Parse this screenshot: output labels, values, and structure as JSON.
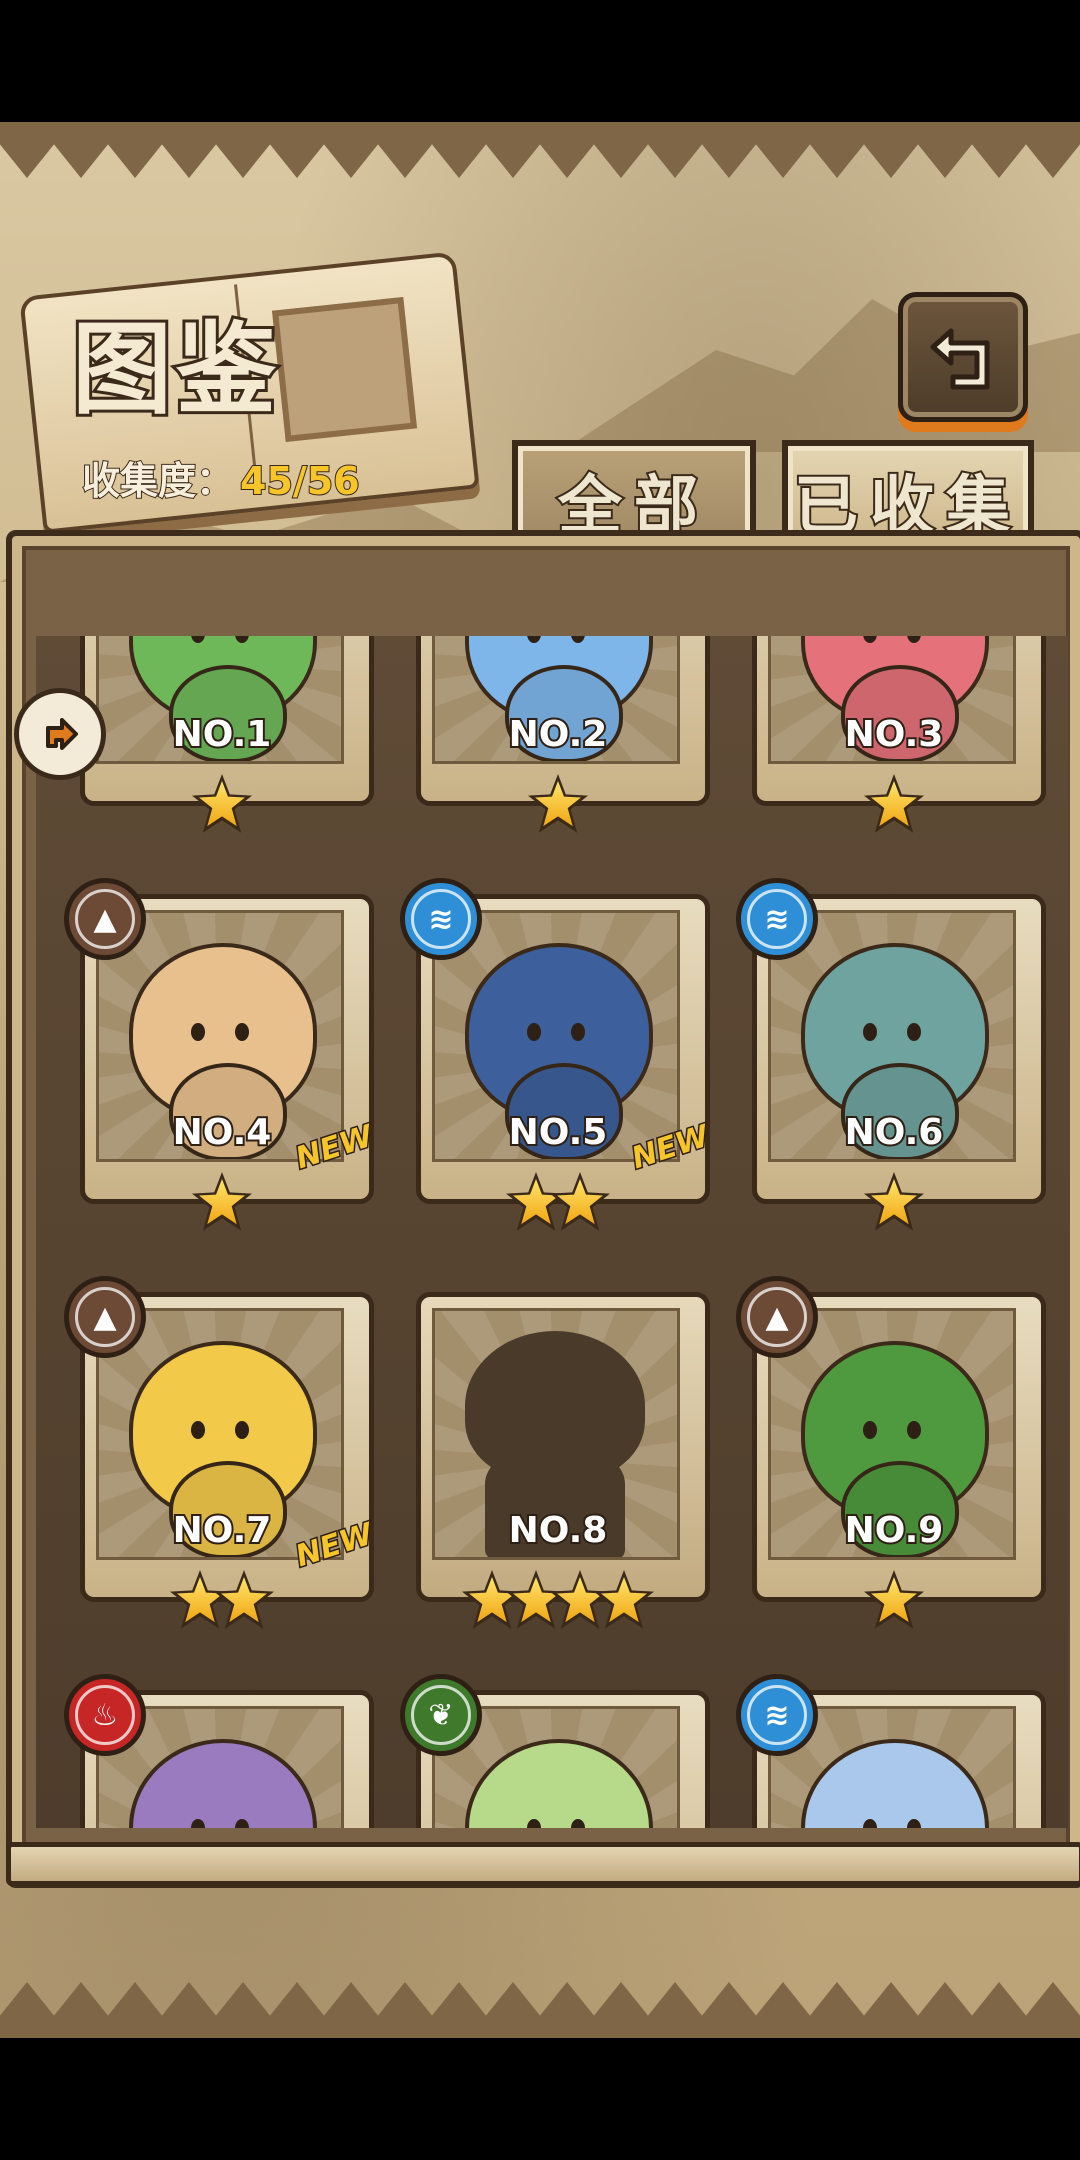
{
  "header": {
    "title": "图鉴",
    "collection_label": "收集度：",
    "collection_value": "45/56"
  },
  "tabs": [
    {
      "label": "全部",
      "active": true
    },
    {
      "label": "已收集",
      "active": false
    }
  ],
  "cards": [
    {
      "number": "NO.1",
      "stars": 1,
      "element": null,
      "is_new": false,
      "locked": false,
      "color": "#6fb85a"
    },
    {
      "number": "NO.2",
      "stars": 1,
      "element": null,
      "is_new": false,
      "locked": false,
      "color": "#7fb6ea"
    },
    {
      "number": "NO.3",
      "stars": 1,
      "element": null,
      "is_new": false,
      "locked": false,
      "color": "#e5717a"
    },
    {
      "number": "NO.4",
      "stars": 1,
      "element": "earth",
      "is_new": true,
      "locked": false,
      "color": "#e8c08e"
    },
    {
      "number": "NO.5",
      "stars": 2,
      "element": "water",
      "is_new": true,
      "locked": false,
      "color": "#3d5f9c"
    },
    {
      "number": "NO.6",
      "stars": 1,
      "element": "water",
      "is_new": false,
      "locked": false,
      "color": "#6fa3a0"
    },
    {
      "number": "NO.7",
      "stars": 2,
      "element": "earth",
      "is_new": true,
      "locked": false,
      "color": "#f3c94a"
    },
    {
      "number": "NO.8",
      "stars": 4,
      "element": null,
      "is_new": false,
      "locked": true,
      "color": "#4a3a2a"
    },
    {
      "number": "NO.9",
      "stars": 1,
      "element": "earth",
      "is_new": false,
      "locked": false,
      "color": "#4f9a3e"
    },
    {
      "number": "",
      "stars": 0,
      "element": "fire",
      "is_new": false,
      "locked": false,
      "color": "#9a7bc0"
    },
    {
      "number": "",
      "stars": 0,
      "element": "grass",
      "is_new": false,
      "locked": false,
      "color": "#b7d98a"
    },
    {
      "number": "",
      "stars": 0,
      "element": "water",
      "is_new": false,
      "locked": false,
      "color": "#a9c8ec"
    }
  ],
  "new_label": "NEW",
  "colors": {
    "accent_orange": "#e07b1d",
    "star_gold": "#f7c51f",
    "frame_dark": "#3b2a1a"
  }
}
